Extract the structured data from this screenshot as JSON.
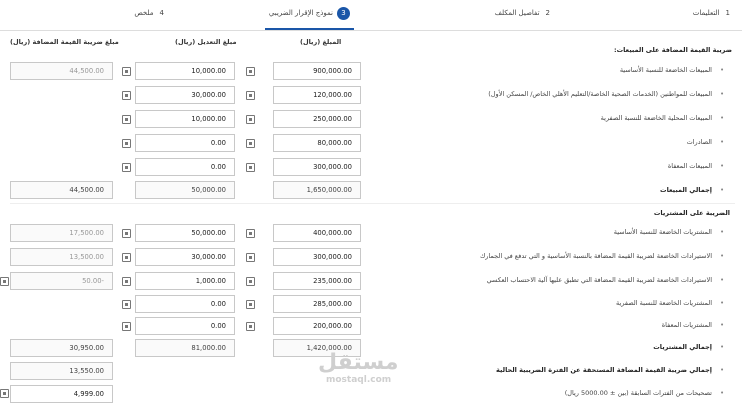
{
  "steps": [
    {
      "num": "1",
      "label": "التعليمات"
    },
    {
      "num": "2",
      "label": "تفاصيل المكلف"
    },
    {
      "num": "3",
      "label": "نموذج الإقرار الضريبي"
    },
    {
      "num": "4",
      "label": "ملخص"
    }
  ],
  "columns": {
    "amount": "المبلغ (ريال)",
    "adjustment": "مبلغ التعديل (ريال)",
    "vat": "مبلغ ضريبة القيمة المضافة (ريال)"
  },
  "sales": {
    "title": "ضريبة القيمة المضافة على المبيعات:",
    "rows": [
      {
        "label": "المبيعات الخاضعة للنسبة الأساسية",
        "amount": "900,000.00",
        "adjustment": "10,000.00",
        "vat": "44,500.00"
      },
      {
        "label": "المبيعات للمواطنين (الخدمات الصحية الخاصة/التعليم الأهلي الخاص/ المسكن الأول)",
        "amount": "120,000.00",
        "adjustment": "30,000.00",
        "vat": ""
      },
      {
        "label": "المبيعات المحلية الخاضعة للنسبة الصفرية",
        "amount": "250,000.00",
        "adjustment": "10,000.00",
        "vat": ""
      },
      {
        "label": "الصادرات",
        "amount": "80,000.00",
        "adjustment": "0.00",
        "vat": ""
      },
      {
        "label": "المبيعات المعفاة",
        "amount": "300,000.00",
        "adjustment": "0.00",
        "vat": ""
      }
    ],
    "total_label": "إجمالي المبيعات",
    "total_amount": "1,650,000.00",
    "total_adjustment": "50,000.00",
    "total_vat": "44,500.00"
  },
  "purchases": {
    "title": "الضريبة على المشتريات",
    "rows": [
      {
        "label": "المشتريات الخاضعة للنسبة الأساسية",
        "amount": "400,000.00",
        "adjustment": "50,000.00",
        "vat": "17,500.00"
      },
      {
        "label": "الاستيرادات الخاضعة لضريبة القيمة المضافة بالنسبة الأساسية و التي تدفع في الجمارك",
        "amount": "300,000.00",
        "adjustment": "30,000.00",
        "vat": "13,500.00"
      },
      {
        "label": "الاستيرادات الخاضعة لضريبة القيمة المضافة التي تطبق عليها آلية الاحتساب العكسي",
        "amount": "235,000.00",
        "adjustment": "1,000.00",
        "vat": "50.00-"
      },
      {
        "label": "المشتريات الخاضعة للنسبة الصفرية",
        "amount": "285,000.00",
        "adjustment": "0.00",
        "vat": ""
      },
      {
        "label": "المشتريات المعفاة",
        "amount": "200,000.00",
        "adjustment": "0.00",
        "vat": ""
      }
    ],
    "total_label": "إجمالي المشتريات",
    "total_amount": "1,420,000.00",
    "total_adjustment": "81,000.00",
    "total_vat": "30,950.00"
  },
  "net": {
    "label": "إجمالي ضريبة القيمة المضافة المستحقة عن الفترة الضريبية الحالية",
    "value": "13,550.00"
  },
  "corrections": {
    "label": "تصحيحات من الفترات السابقة (بين ± 5000.00 ريال)",
    "value": "4,999.00"
  },
  "watermark": {
    "arabic": "مستقل",
    "latin": "mostaql.com"
  }
}
